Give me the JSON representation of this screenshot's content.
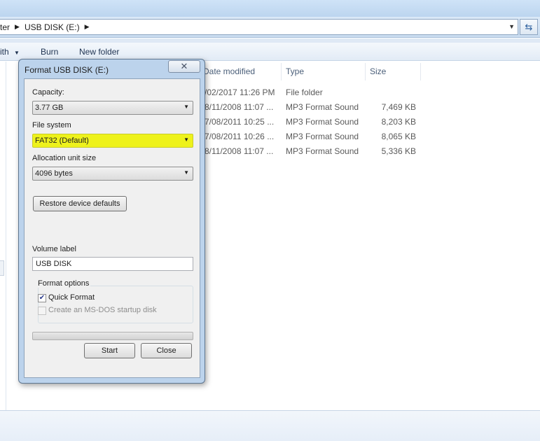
{
  "explorer": {
    "breadcrumbs": [
      "ter",
      "USB DISK (E:)"
    ],
    "toolbar": {
      "items": [
        "ith",
        "Burn",
        "New folder"
      ]
    },
    "columns": [
      "Date modified",
      "Type",
      "Size"
    ],
    "rows": [
      {
        "date": "/02/2017 11:26 PM",
        "type": "File folder",
        "size": ""
      },
      {
        "date": "8/11/2008 11:07 ...",
        "type": "MP3 Format Sound",
        "size": "7,469 KB"
      },
      {
        "date": "7/08/2011 10:25 ...",
        "type": "MP3 Format Sound",
        "size": "8,203 KB"
      },
      {
        "date": "7/08/2011 10:26 ...",
        "type": "MP3 Format Sound",
        "size": "8,065 KB"
      },
      {
        "date": "8/11/2008 11:07 ...",
        "type": "MP3 Format Sound",
        "size": "5,336 KB"
      }
    ]
  },
  "dialog": {
    "title": "Format USB DISK (E:)",
    "close_glyph": "✕",
    "capacity": {
      "label": "Capacity:",
      "value": "3.77 GB"
    },
    "file_system": {
      "label": "File system",
      "value": "FAT32 (Default)",
      "highlight_color": "#eef21b"
    },
    "allocation": {
      "label": "Allocation unit size",
      "value": "4096 bytes"
    },
    "restore_label": "Restore device defaults",
    "volume": {
      "label": "Volume label",
      "value": "USB DISK"
    },
    "format_options": {
      "title": "Format options",
      "quick_format": {
        "label": "Quick Format",
        "checked": true
      },
      "msdos": {
        "label": "Create an MS-DOS startup disk",
        "checked": false,
        "enabled": false
      }
    },
    "progress": 0,
    "start_label": "Start",
    "close_label": "Close"
  }
}
